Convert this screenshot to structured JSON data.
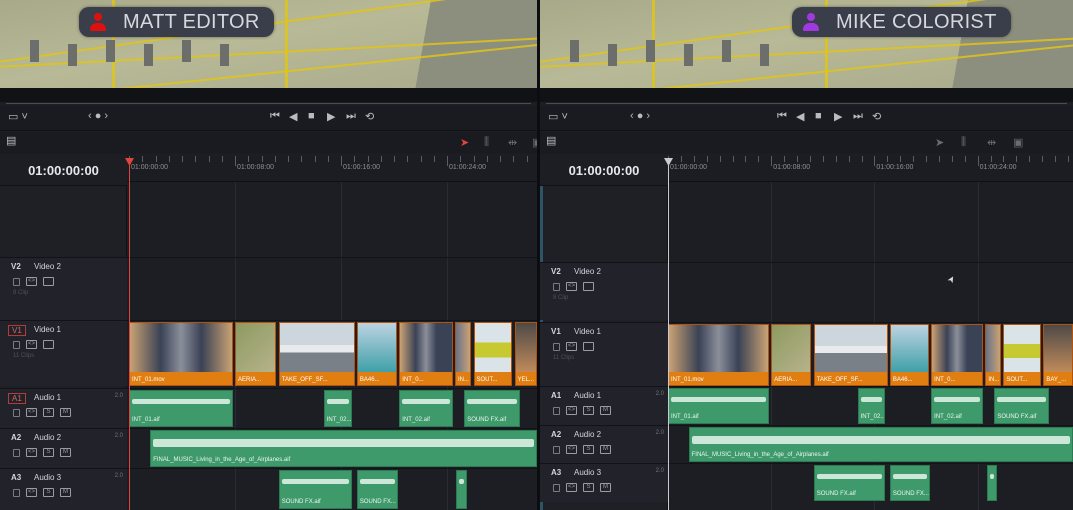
{
  "timeline": {
    "timecode": "01:00:00:00",
    "ruler_labels": [
      "01:00:00:00",
      "01:00:08:00",
      "01:00:16:00",
      "01:00:24:00"
    ],
    "ruler_seconds": [
      0,
      8,
      16,
      24
    ],
    "transport_icons": [
      "skip-to-start-icon",
      "step-back-icon",
      "stop-icon",
      "play-icon",
      "skip-to-end-icon",
      "loop-icon"
    ],
    "tracks": [
      {
        "id": "V2",
        "name": "Video 2",
        "count": "8 Clip",
        "kind": "video-empty"
      },
      {
        "id": "V1",
        "name": "Video 1",
        "count": "11 Clips",
        "kind": "video"
      },
      {
        "id": "A1",
        "name": "Audio 1",
        "channels": "2.0",
        "kind": "audio"
      },
      {
        "id": "A2",
        "name": "Audio 2",
        "channels": "2.0",
        "kind": "audio"
      },
      {
        "id": "A3",
        "name": "Audio 3",
        "channels": "2.0",
        "kind": "audio"
      }
    ],
    "v1_clips": [
      {
        "start": 0,
        "end": 7.9
      },
      {
        "start": 8,
        "end": 11.2
      },
      {
        "start": 11.3,
        "end": 17.1
      },
      {
        "start": 17.2,
        "end": 20.3
      },
      {
        "start": 20.4,
        "end": 24.5
      },
      {
        "start": 24.6,
        "end": 25.9
      },
      {
        "start": 26.0,
        "end": 29.0
      },
      {
        "start": 29.1,
        "end": 32
      }
    ],
    "a1_clips": [
      {
        "start": 0,
        "end": 7.9,
        "label": "INT_01.aif"
      },
      {
        "start": 14.7,
        "end": 16.9,
        "label": "INT_02..."
      },
      {
        "start": 20.4,
        "end": 24.5,
        "label": "INT_02.aif"
      },
      {
        "start": 25.3,
        "end": 29.6,
        "label": "SOUND FX.aif"
      }
    ],
    "a2_clips": [
      {
        "start": 1.6,
        "end": 40,
        "label": "FINAL_MUSIC_Living_in_the_Age_of_Airplanes.aif"
      }
    ],
    "a3_clips": [
      {
        "start": 11.3,
        "end": 16.9,
        "label": "SOUND FX.aif"
      },
      {
        "start": 17.2,
        "end": 20.4,
        "label": "SOUND FX..."
      },
      {
        "start": 24.7,
        "end": 25.6,
        "label": ""
      }
    ]
  },
  "panels": [
    {
      "user": "MATT EDITOR",
      "user_color": "#e01010",
      "playhead_color": "#e0443c",
      "v1_labels": [
        "INT_01.mov",
        "AERIA...",
        "TAKE_OFF_SF...",
        "BA46...",
        "INT_0...",
        "IN...",
        "SOUT...",
        "YEL..."
      ],
      "selected_tracks": [
        "V1",
        "A1"
      ]
    },
    {
      "user": "MIKE COLORIST",
      "user_color": "#a03ae0",
      "playhead_color": "#c9cbd1",
      "v1_labels": [
        "INT_01.mov",
        "AERIA...",
        "TAKE_OFF_SF...",
        "BA46...",
        "INT_0...",
        "IN...",
        "SOUT...",
        "BAY_..."
      ],
      "selected_tracks": []
    }
  ]
}
